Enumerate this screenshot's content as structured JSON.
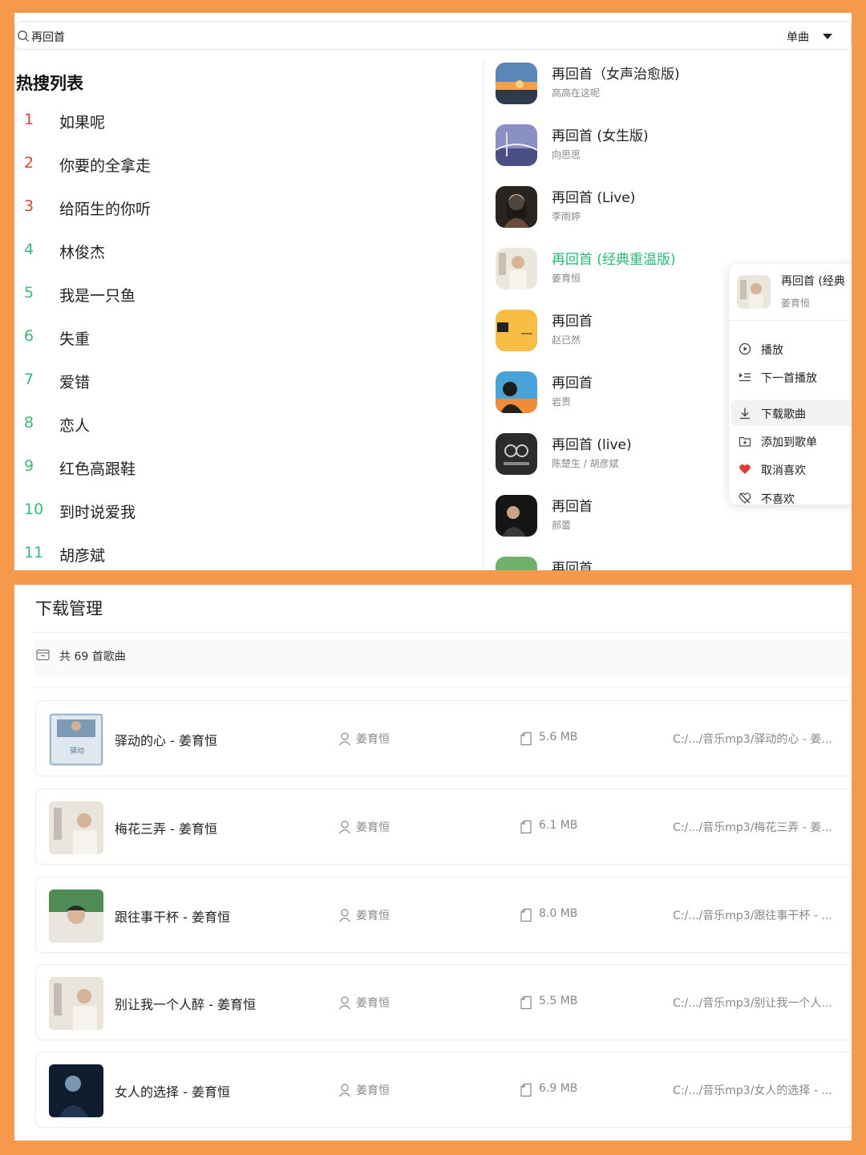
{
  "search": {
    "query": "再回首",
    "type_label": "单曲"
  },
  "hot_list": {
    "title": "热搜列表",
    "items": [
      {
        "rank": "1",
        "name": "如果呢"
      },
      {
        "rank": "2",
        "name": "你要的全拿走"
      },
      {
        "rank": "3",
        "name": "给陌生的你听"
      },
      {
        "rank": "4",
        "name": "林俊杰"
      },
      {
        "rank": "5",
        "name": "我是一只鱼"
      },
      {
        "rank": "6",
        "name": "失重"
      },
      {
        "rank": "7",
        "name": "爱错"
      },
      {
        "rank": "8",
        "name": "恋人"
      },
      {
        "rank": "9",
        "name": "红色高跟鞋"
      },
      {
        "rank": "10",
        "name": "到时说爱我"
      },
      {
        "rank": "11",
        "name": "胡彦斌"
      }
    ]
  },
  "results": [
    {
      "title": "再回首（女声治愈版)",
      "artist": "高高在这呢",
      "active": false
    },
    {
      "title": "再回首 (女生版)",
      "artist": "向思思",
      "active": false
    },
    {
      "title": "再回首 (Live)",
      "artist": "李雨婷",
      "active": false
    },
    {
      "title": "再回首 (经典重温版)",
      "artist": "姜育恒",
      "active": true
    },
    {
      "title": "再回首",
      "artist": "赵已然",
      "active": false
    },
    {
      "title": "再回首",
      "artist": "岩贵",
      "active": false
    },
    {
      "title": "再回首 (live)",
      "artist": "陈楚生 / 胡彦斌",
      "active": false
    },
    {
      "title": "再回首",
      "artist": "郝蕾",
      "active": false
    },
    {
      "title": "再回首",
      "artist": "",
      "active": false
    }
  ],
  "context_menu": {
    "song_title": "再回首 (经典",
    "song_artist": "姜育恒",
    "items": [
      {
        "label": "播放",
        "icon": "play-circle-icon"
      },
      {
        "label": "下一首播放",
        "icon": "play-next-icon"
      },
      {
        "label": "下载歌曲",
        "icon": "download-icon"
      },
      {
        "label": "添加到歌单",
        "icon": "add-to-playlist-icon"
      },
      {
        "label": "取消喜欢",
        "icon": "heart-filled-icon"
      },
      {
        "label": "不喜欢",
        "icon": "dislike-icon"
      }
    ]
  },
  "download_manager": {
    "title": "下载管理",
    "count_text": "共 69 首歌曲",
    "rows": [
      {
        "name": "驿动的心 - 姜育恒",
        "artist": "姜育恒",
        "size": "5.6 MB",
        "path": "C:/.../音乐mp3/驿动的心 - 姜..."
      },
      {
        "name": "梅花三弄 - 姜育恒",
        "artist": "姜育恒",
        "size": "6.1 MB",
        "path": "C:/.../音乐mp3/梅花三弄 - 姜..."
      },
      {
        "name": "跟往事干杯 - 姜育恒",
        "artist": "姜育恒",
        "size": "8.0 MB",
        "path": "C:/.../音乐mp3/跟往事干杯 - ..."
      },
      {
        "name": "别让我一个人醉 - 姜育恒",
        "artist": "姜育恒",
        "size": "5.5 MB",
        "path": "C:/.../音乐mp3/别让我一个人..."
      },
      {
        "name": "女人的选择 - 姜育恒",
        "artist": "姜育恒",
        "size": "6.9 MB",
        "path": "C:/.../音乐mp3/女人的选择 - ..."
      }
    ]
  },
  "colors": {
    "background": "#f59a4c",
    "accent_green": "#2bb673",
    "rank_red": "#e0403c",
    "heart_red": "#e53935"
  }
}
